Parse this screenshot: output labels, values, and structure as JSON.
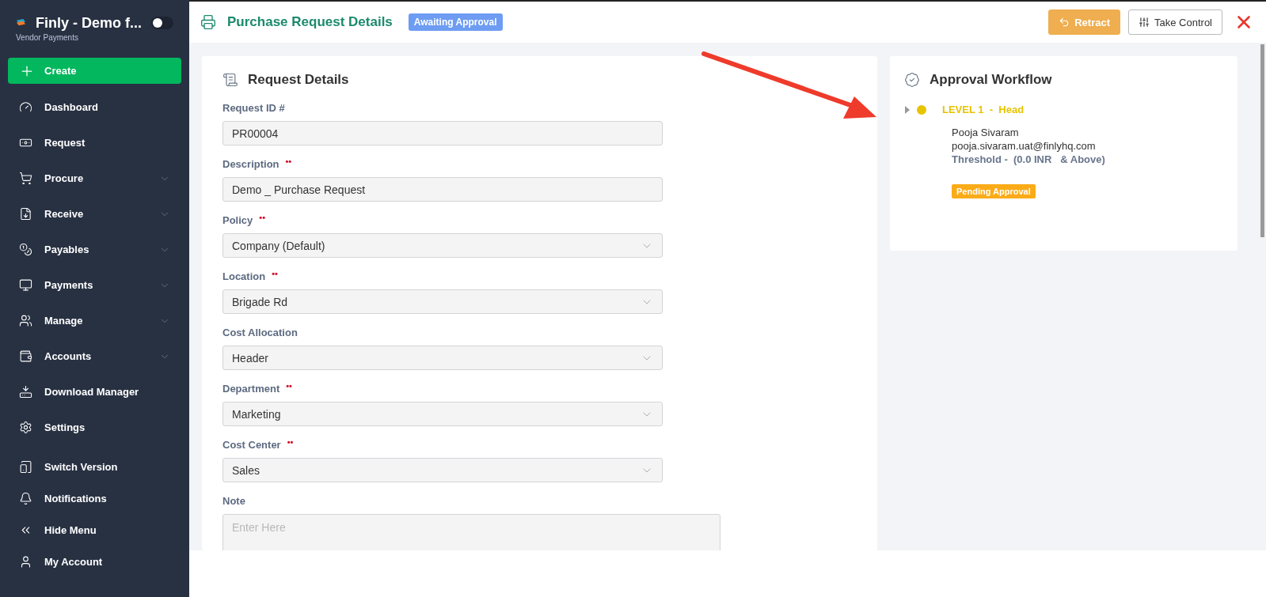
{
  "brand": {
    "name": "Finly - Demo f...",
    "subtitle": "Vendor Payments",
    "toggle_on": false
  },
  "sidebar": {
    "items": [
      {
        "label": "Create",
        "kind": "create",
        "expandable": false
      },
      {
        "label": "Dashboard",
        "kind": "nav",
        "expandable": false
      },
      {
        "label": "Request",
        "kind": "nav",
        "expandable": false
      },
      {
        "label": "Procure",
        "kind": "nav",
        "expandable": true
      },
      {
        "label": "Receive",
        "kind": "nav",
        "expandable": true
      },
      {
        "label": "Payables",
        "kind": "nav",
        "expandable": true
      },
      {
        "label": "Payments",
        "kind": "nav",
        "expandable": true
      },
      {
        "label": "Manage",
        "kind": "nav",
        "expandable": true
      },
      {
        "label": "Accounts",
        "kind": "nav",
        "expandable": true
      },
      {
        "label": "Download Manager",
        "kind": "nav",
        "expandable": false
      },
      {
        "label": "Settings",
        "kind": "nav",
        "expandable": false
      },
      {
        "label": "Switch Version",
        "kind": "util",
        "expandable": false
      },
      {
        "label": "Notifications",
        "kind": "util",
        "expandable": false
      },
      {
        "label": "Hide Menu",
        "kind": "util",
        "expandable": false
      },
      {
        "label": "My Account",
        "kind": "util",
        "expandable": false
      }
    ]
  },
  "header": {
    "title": "Purchase Request Details",
    "status": "Awaiting Approval",
    "buttons": [
      {
        "label": "Retract",
        "kind": "primary"
      },
      {
        "label": "Take Control",
        "kind": "outline"
      }
    ]
  },
  "request_details": {
    "title": "Request Details",
    "fields": [
      {
        "label": "Request ID #",
        "kind": "text",
        "value": "PR00004"
      },
      {
        "label": "Description",
        "kind": "text",
        "required_mark": "••",
        "value": "Demo _ Purchase Request"
      },
      {
        "label": "Policy",
        "kind": "select",
        "required_mark": "••",
        "value": "Company (Default)"
      },
      {
        "label": "Location",
        "kind": "select",
        "required_mark": "••",
        "value": "Brigade Rd"
      },
      {
        "label": "Cost Allocation",
        "kind": "select",
        "value": "Header"
      },
      {
        "label": "Department",
        "kind": "select",
        "required_mark": "••",
        "value": "Marketing"
      },
      {
        "label": "Cost Center",
        "kind": "select",
        "required_mark": "••",
        "value": "Sales"
      },
      {
        "label": "Note",
        "kind": "textarea",
        "placeholder": "Enter Here"
      }
    ]
  },
  "approval_workflow": {
    "title": "Approval Workflow",
    "levels": [
      {
        "title": "LEVEL 1  -  Head",
        "expanded": false,
        "color": "#e8c300",
        "approver": "Pooja Sivaram",
        "email": "pooja.sivaram.uat@finlyhq.com",
        "threshold": "Threshold -  (0.0 INR   & Above)",
        "status": "Pending Approval"
      }
    ]
  }
}
